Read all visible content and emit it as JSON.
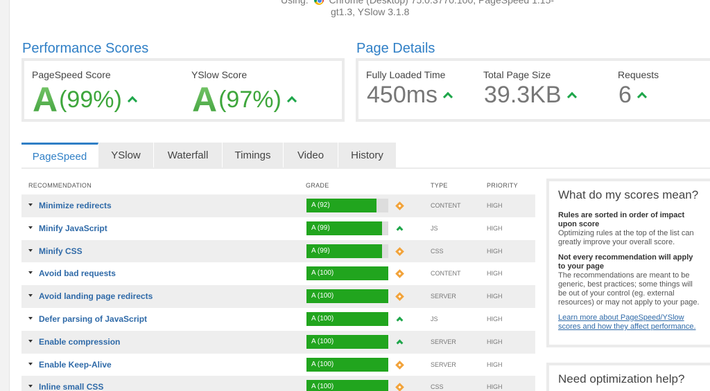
{
  "header": {
    "using_label": "Using:",
    "using_text": "Chrome (Desktop) 75.0.3770.100, PageSpeed 1.15-",
    "using_line2": "gt1.3, YSlow 3.1.8"
  },
  "performance": {
    "title": "Performance Scores",
    "pagespeed": {
      "label": "PageSpeed Score",
      "grade": "A",
      "percent": "(99%)"
    },
    "yslow": {
      "label": "YSlow Score",
      "grade": "A",
      "percent": "(97%)"
    }
  },
  "details": {
    "title": "Page Details",
    "load_time": {
      "label": "Fully Loaded Time",
      "value": "450ms"
    },
    "page_size": {
      "label": "Total Page Size",
      "value": "39.3KB"
    },
    "requests": {
      "label": "Requests",
      "value": "6"
    }
  },
  "tabs": [
    "PageSpeed",
    "YSlow",
    "Waterfall",
    "Timings",
    "Video",
    "History"
  ],
  "active_tab": "PageSpeed",
  "table": {
    "headers": {
      "recommendation": "RECOMMENDATION",
      "grade": "GRADE",
      "type": "TYPE",
      "priority": "PRIORITY"
    },
    "rows": [
      {
        "name": "Minimize redirects",
        "grade": "A (92)",
        "score": 92,
        "trend": "diamond",
        "type": "CONTENT",
        "priority": "HIGH"
      },
      {
        "name": "Minify JavaScript",
        "grade": "A (99)",
        "score": 99,
        "trend": "up",
        "type": "JS",
        "priority": "HIGH"
      },
      {
        "name": "Minify CSS",
        "grade": "A (99)",
        "score": 99,
        "trend": "diamond",
        "type": "CSS",
        "priority": "HIGH"
      },
      {
        "name": "Avoid bad requests",
        "grade": "A (100)",
        "score": 100,
        "trend": "diamond",
        "type": "CONTENT",
        "priority": "HIGH"
      },
      {
        "name": "Avoid landing page redirects",
        "grade": "A (100)",
        "score": 100,
        "trend": "diamond",
        "type": "SERVER",
        "priority": "HIGH"
      },
      {
        "name": "Defer parsing of JavaScript",
        "grade": "A (100)",
        "score": 100,
        "trend": "up",
        "type": "JS",
        "priority": "HIGH"
      },
      {
        "name": "Enable compression",
        "grade": "A (100)",
        "score": 100,
        "trend": "up",
        "type": "SERVER",
        "priority": "HIGH"
      },
      {
        "name": "Enable Keep-Alive",
        "grade": "A (100)",
        "score": 100,
        "trend": "diamond",
        "type": "SERVER",
        "priority": "HIGH"
      },
      {
        "name": "Inline small CSS",
        "grade": "A (100)",
        "score": 100,
        "trend": "diamond",
        "type": "CSS",
        "priority": "HIGH"
      }
    ]
  },
  "sidebar": {
    "scores_box": {
      "title": "What do my scores mean?",
      "h1": "Rules are sorted in order of impact upon score",
      "p1": "Optimizing rules at the top of the list can greatly improve your overall score.",
      "h2": "Not every recommendation will apply to your page",
      "p2": "The recommendations are meant to be generic, best practices; some things will be out of your control (eg. external resources) or may not apply to your page.",
      "link": "Learn more about PageSpeed/YSlow scores and how they affect performance."
    },
    "help_box": {
      "title": "Need optimization help?"
    }
  },
  "colors": {
    "accent": "#2f7fc6",
    "grade_green": "#21a51e",
    "trend_up": "#1ea64a",
    "trend_neutral": "#f2a33a"
  }
}
